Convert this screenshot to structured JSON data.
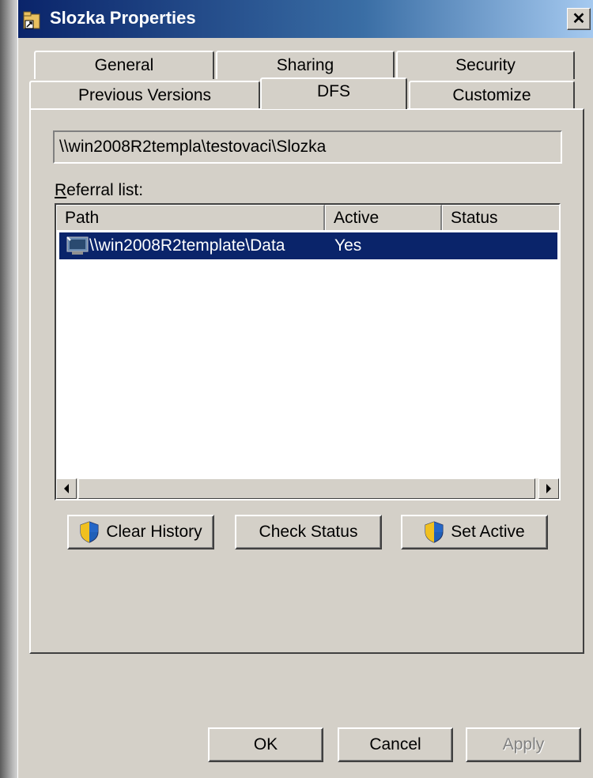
{
  "window": {
    "title": "Slozka Properties",
    "close_glyph": "✕"
  },
  "tabs": {
    "row1": [
      {
        "label": "General"
      },
      {
        "label": "Sharing"
      },
      {
        "label": "Security"
      }
    ],
    "row2": [
      {
        "label": "Previous Versions"
      },
      {
        "label": "DFS",
        "active": true
      },
      {
        "label": "Customize"
      }
    ]
  },
  "dfs": {
    "path_value": "\\\\win2008R2templa\\testovaci\\Slozka",
    "referral_label": "Referral list:",
    "columns": [
      "Path",
      "Active",
      "Status"
    ],
    "rows": [
      {
        "path": "\\\\win2008R2template\\Data",
        "active": "Yes",
        "status": "",
        "selected": true
      }
    ],
    "buttons": {
      "clear_history": "Clear History",
      "check_status": "Check Status",
      "set_active": "Set Active"
    }
  },
  "footer": {
    "ok": "OK",
    "cancel": "Cancel",
    "apply": "Apply"
  },
  "colors": {
    "face": "#d4d0c8",
    "selection": "#0a246a",
    "title_start": "#0a246a",
    "title_end": "#a6caf0"
  },
  "icons": [
    "folder-icon",
    "close-icon",
    "network-share-icon",
    "uac-shield-icon",
    "scroll-left-icon",
    "scroll-right-icon"
  ]
}
